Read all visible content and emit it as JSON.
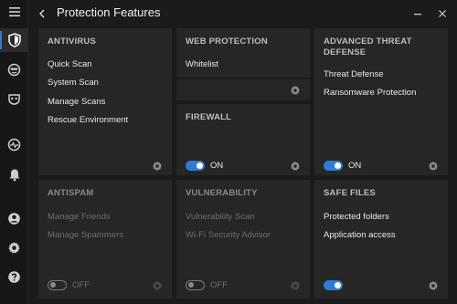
{
  "header": {
    "title": "Protection Features"
  },
  "sidebar": {
    "items": [
      {
        "icon": "hamburger-menu-icon"
      },
      {
        "icon": "shield-icon",
        "active": true
      },
      {
        "icon": "antispam-face-icon"
      },
      {
        "icon": "privacy-mask-icon"
      },
      {
        "icon": "pulse-activity-icon"
      },
      {
        "icon": "bell-icon"
      },
      {
        "icon": "account-icon"
      },
      {
        "icon": "gear-icon"
      },
      {
        "icon": "help-icon"
      }
    ]
  },
  "cards": {
    "antivirus": {
      "title": "ANTIVIRUS",
      "items": [
        "Quick Scan",
        "System Scan",
        "Manage Scans",
        "Rescue Environment"
      ]
    },
    "web_protection": {
      "title": "WEB PROTECTION",
      "items": [
        "Whitelist"
      ]
    },
    "firewall": {
      "title": "FIREWALL",
      "toggle": "ON"
    },
    "advanced_threat_defense": {
      "title": "ADVANCED THREAT DEFENSE",
      "items": [
        "Threat Defense",
        "Ransomware Protection"
      ],
      "toggle": "ON"
    },
    "antispam": {
      "title": "ANTISPAM",
      "items": [
        "Manage Friends",
        "Manage Spammers"
      ],
      "toggle": "OFF"
    },
    "vulnerability": {
      "title": "VULNERABILITY",
      "items": [
        "Vulnerability Scan",
        "Wi-Fi Security Advisor"
      ],
      "toggle": "OFF"
    },
    "safe_files": {
      "title": "SAFE FILES",
      "items": [
        "Protected folders",
        "Application access"
      ]
    }
  },
  "colors": {
    "accent": "#2f7bd6",
    "card_bg": "#262626",
    "app_bg": "#1b1b1b"
  }
}
